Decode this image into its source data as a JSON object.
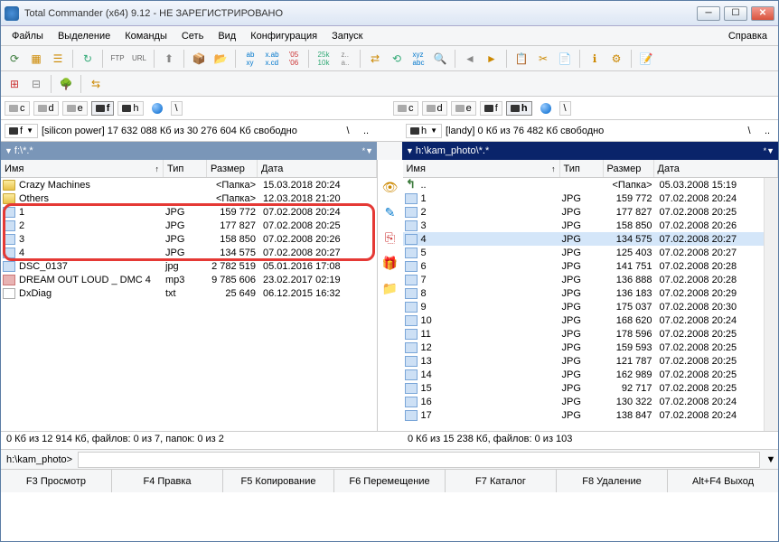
{
  "window": {
    "title": "Total Commander (x64) 9.12 - НЕ ЗАРЕГИСТРИРОВАНО"
  },
  "menubar": {
    "items": [
      "Файлы",
      "Выделение",
      "Команды",
      "Сеть",
      "Вид",
      "Конфигурация",
      "Запуск"
    ],
    "help": "Справка"
  },
  "drives": {
    "left": [
      "c",
      "d",
      "e",
      "f",
      "h"
    ],
    "right": [
      "c",
      "d",
      "e",
      "f",
      "h"
    ],
    "active_left": "f",
    "active_right": "h",
    "backslash": "\\"
  },
  "info": {
    "left_drive": "f",
    "left_label": "[silicon power]",
    "left_space": "17 632 088 Кб из 30 276 604 Кб свободно",
    "right_drive": "h",
    "right_label": "[landy]",
    "right_space": "0 Кб из 76 482 Кб свободно",
    "nav_back": "\\",
    "nav_up": ".."
  },
  "path": {
    "left": "f:\\*.*",
    "right": "h:\\kam_photo\\*.*"
  },
  "cols": {
    "name": "Имя",
    "ext": "Тип",
    "size": "Размер",
    "date": "Дата"
  },
  "left_files": [
    {
      "icon": "folder",
      "name": "Crazy Machines",
      "ext": "",
      "size": "<Папка>",
      "date": "15.03.2018 20:24"
    },
    {
      "icon": "folder",
      "name": "Others",
      "ext": "",
      "size": "<Папка>",
      "date": "12.03.2018 21:20"
    },
    {
      "icon": "jpg",
      "name": "1",
      "ext": "JPG",
      "size": "159 772",
      "date": "07.02.2008 20:24",
      "hl": true
    },
    {
      "icon": "jpg",
      "name": "2",
      "ext": "JPG",
      "size": "177 827",
      "date": "07.02.2008 20:25",
      "hl": true
    },
    {
      "icon": "jpg",
      "name": "3",
      "ext": "JPG",
      "size": "158 850",
      "date": "07.02.2008 20:26",
      "hl": true
    },
    {
      "icon": "jpg",
      "name": "4",
      "ext": "JPG",
      "size": "134 575",
      "date": "07.02.2008 20:27",
      "hl": true
    },
    {
      "icon": "jpg",
      "name": "DSC_0137",
      "ext": "jpg",
      "size": "2 782 519",
      "date": "05.01.2016 17:08"
    },
    {
      "icon": "mp3",
      "name": "DREAM OUT LOUD _ DMC 4",
      "ext": "mp3",
      "size": "9 785 606",
      "date": "23.02.2017 02:19"
    },
    {
      "icon": "txt",
      "name": "DxDiag",
      "ext": "txt",
      "size": "25 649",
      "date": "06.12.2015 16:32"
    }
  ],
  "right_files": [
    {
      "icon": "up",
      "name": "..",
      "ext": "",
      "size": "<Папка>",
      "date": "05.03.2008 15:19"
    },
    {
      "icon": "jpg",
      "name": "1",
      "ext": "JPG",
      "size": "159 772",
      "date": "07.02.2008 20:24"
    },
    {
      "icon": "jpg",
      "name": "2",
      "ext": "JPG",
      "size": "177 827",
      "date": "07.02.2008 20:25"
    },
    {
      "icon": "jpg",
      "name": "3",
      "ext": "JPG",
      "size": "158 850",
      "date": "07.02.2008 20:26"
    },
    {
      "icon": "jpg",
      "name": "4",
      "ext": "JPG",
      "size": "134 575",
      "date": "07.02.2008 20:27",
      "selected": true
    },
    {
      "icon": "jpg",
      "name": "5",
      "ext": "JPG",
      "size": "125 403",
      "date": "07.02.2008 20:27"
    },
    {
      "icon": "jpg",
      "name": "6",
      "ext": "JPG",
      "size": "141 751",
      "date": "07.02.2008 20:28"
    },
    {
      "icon": "jpg",
      "name": "7",
      "ext": "JPG",
      "size": "136 888",
      "date": "07.02.2008 20:28"
    },
    {
      "icon": "jpg",
      "name": "8",
      "ext": "JPG",
      "size": "136 183",
      "date": "07.02.2008 20:29"
    },
    {
      "icon": "jpg",
      "name": "9",
      "ext": "JPG",
      "size": "175 037",
      "date": "07.02.2008 20:30"
    },
    {
      "icon": "jpg",
      "name": "10",
      "ext": "JPG",
      "size": "168 620",
      "date": "07.02.2008 20:24"
    },
    {
      "icon": "jpg",
      "name": "11",
      "ext": "JPG",
      "size": "178 596",
      "date": "07.02.2008 20:25"
    },
    {
      "icon": "jpg",
      "name": "12",
      "ext": "JPG",
      "size": "159 593",
      "date": "07.02.2008 20:25"
    },
    {
      "icon": "jpg",
      "name": "13",
      "ext": "JPG",
      "size": "121 787",
      "date": "07.02.2008 20:25"
    },
    {
      "icon": "jpg",
      "name": "14",
      "ext": "JPG",
      "size": "162 989",
      "date": "07.02.2008 20:25"
    },
    {
      "icon": "jpg",
      "name": "15",
      "ext": "JPG",
      "size": "92 717",
      "date": "07.02.2008 20:25"
    },
    {
      "icon": "jpg",
      "name": "16",
      "ext": "JPG",
      "size": "130 322",
      "date": "07.02.2008 20:24"
    },
    {
      "icon": "jpg",
      "name": "17",
      "ext": "JPG",
      "size": "138 847",
      "date": "07.02.2008 20:24"
    }
  ],
  "midbar": {
    "icons": [
      "view",
      "edit",
      "copy",
      "pack",
      "sync"
    ]
  },
  "status": {
    "left": "0 Кб из 12 914 Кб, файлов: 0 из 7, папок: 0 из 2",
    "right": "0 Кб из 15 238 Кб, файлов: 0 из 103"
  },
  "cmdline": {
    "prompt": "h:\\kam_photo>"
  },
  "fkeys": [
    "F3 Просмотр",
    "F4 Правка",
    "F5 Копирование",
    "F6 Перемещение",
    "F7 Каталог",
    "F8 Удаление",
    "Alt+F4 Выход"
  ]
}
